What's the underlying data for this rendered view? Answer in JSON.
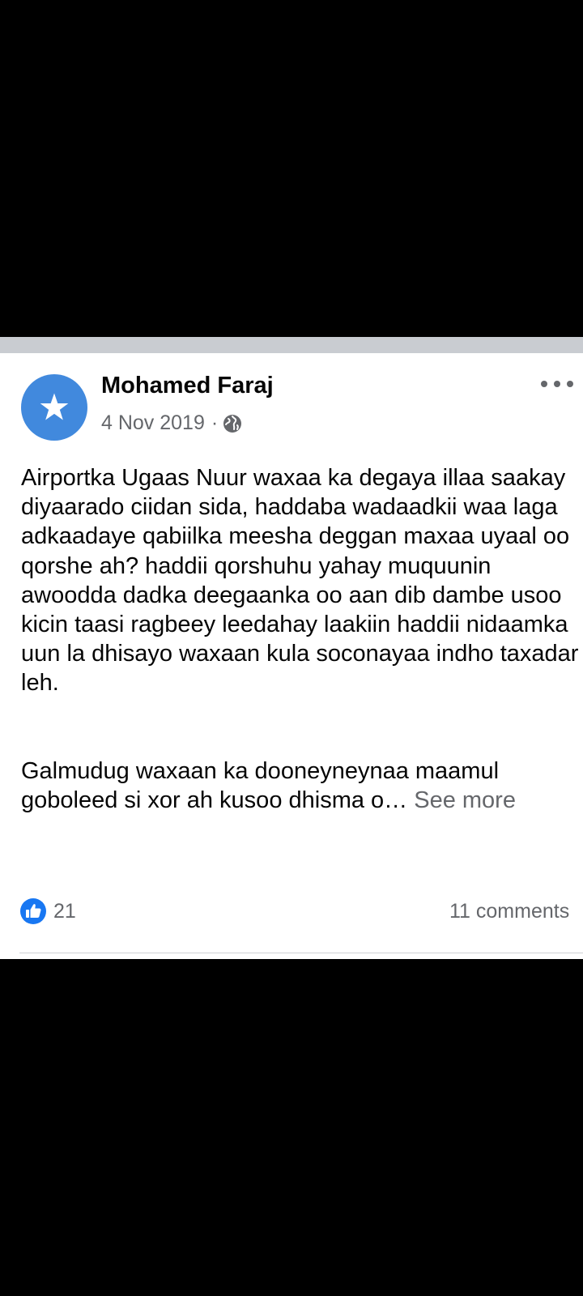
{
  "post": {
    "author": "Mohamed Faraj",
    "date": "4 Nov 2019",
    "separator": "·",
    "privacy_icon": "globe-icon",
    "avatar_icon": "star-icon",
    "body_paragraph_1": "Airportka Ugaas Nuur waxaa ka degaya illaa saakay diyaarado ciidan sida, haddaba wadaadkii waa laga adkaadaye qabiilka meesha deggan maxaa uyaal oo qorshe ah? haddii qorshuhu yahay muquunin awoodda dadka deegaanka oo aan dib dambe usoo kicin taasi ragbeey leedahay laakiin haddii nidaamka uun la dhisayo waxaan kula soconayaa indho taxadar leh.",
    "body_paragraph_2": "Galmudug waxaan ka dooneyneynaa maamul goboleed si xor ah kusoo dhisma o…",
    "see_more": "See more",
    "like_count": "21",
    "comments": "11 comments"
  },
  "colors": {
    "avatar_bg": "#4189dd",
    "separator_bar": "#c9ccd1",
    "secondary_text": "#65676b",
    "like_blue": "#1877f2"
  }
}
